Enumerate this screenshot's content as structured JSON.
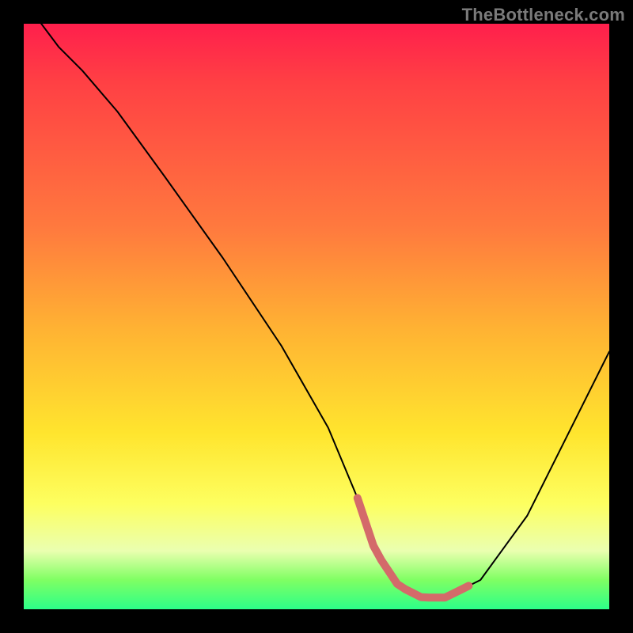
{
  "watermark": "TheBottleneck.com",
  "chart_data": {
    "type": "line",
    "title": "",
    "xlabel": "",
    "ylabel": "",
    "xlim": [
      0,
      100
    ],
    "ylim": [
      0,
      100
    ],
    "grid": false,
    "series": [
      {
        "name": "curve",
        "color": "#000000",
        "x": [
          3,
          6,
          10,
          16,
          24,
          34,
          44,
          52,
          57,
          60,
          64,
          68,
          72,
          78,
          86,
          94,
          100
        ],
        "y": [
          100,
          96,
          92,
          85,
          74,
          60,
          45,
          31,
          19,
          10,
          4,
          2,
          2,
          5,
          16,
          32,
          44
        ]
      }
    ],
    "highlight_segment": {
      "name": "optimal-range",
      "color": "#d46a6a",
      "x_start": 57,
      "x_end": 76,
      "note": "plateau region near minimum"
    }
  }
}
